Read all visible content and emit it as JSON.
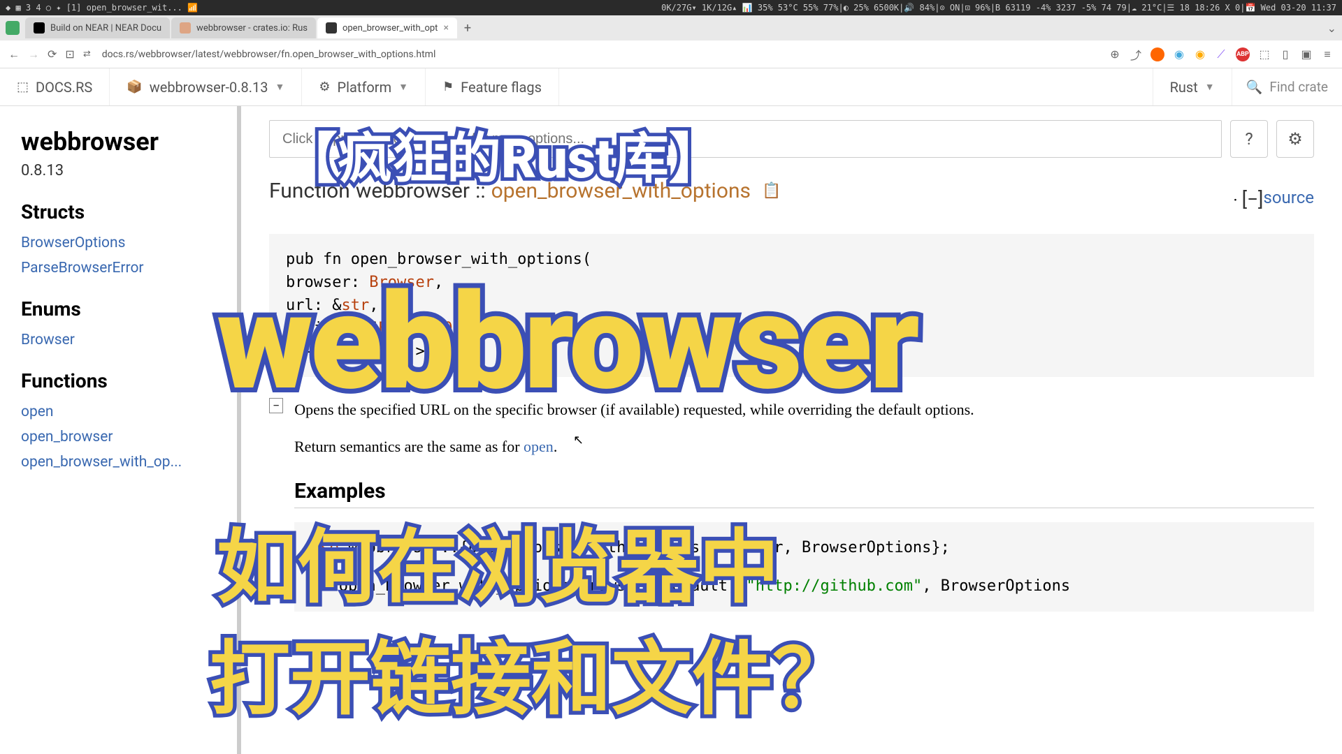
{
  "status_bar": {
    "left": [
      "◆",
      "▦",
      "3",
      "4",
      "○",
      "✦",
      "[1]",
      "open_browser_wit...",
      "📶"
    ],
    "right": [
      "0K/27G▾",
      "1K/12G▴",
      "📊 35% 53°C 55% 77%|◐ 25% 6500K|🔊 84%|⊙ ON|⊡ 96%|B 63119 -4% 3237 -5% 74 79|☁ 21°C|☰ 18 18:26 X 0|📅 Wed 03-20 11:37"
    ]
  },
  "tabs": [
    {
      "label": "Build on NEAR | NEAR Docu",
      "icon": "N"
    },
    {
      "label": "webbrowser - crates.io: Rus",
      "icon": "📦"
    },
    {
      "label": "open_browser_with_opt",
      "icon": "⊕",
      "active": true
    }
  ],
  "url": "docs.rs/webbrowser/latest/webbrowser/fn.open_browser_with_options.html",
  "docs_nav": {
    "home": "DOCS.RS",
    "crate": "webbrowser-0.8.13",
    "platform": "Platform",
    "features": "Feature flags",
    "lang": "Rust",
    "search_placeholder": "Find crate"
  },
  "sidebar": {
    "title": "webbrowser",
    "version": "0.8.13",
    "sections": [
      {
        "heading": "Structs",
        "items": [
          "BrowserOptions",
          "ParseBrowserError"
        ]
      },
      {
        "heading": "Enums",
        "items": [
          "Browser"
        ]
      },
      {
        "heading": "Functions",
        "items": [
          "open",
          "open_browser",
          "open_browser_with_op..."
        ]
      }
    ]
  },
  "content": {
    "search_placeholder": "Click or press 'S' to search, '?' for more options...",
    "fn_prefix": "Function ",
    "fn_crate": "webbrowser",
    "fn_sep": "::",
    "fn_name": "open_browser_with_options",
    "source": "source",
    "collapse": "[−]",
    "code_line1": "pub fn open_browser_with_options(",
    "code_line2": "    browser: ",
    "code_line3": "    url: &",
    "code_line4": "    options: &",
    "code_line5": ") -> Result<()>",
    "desc1": "Opens the specified URL on the specific browser (if available) requested, while overriding the default options.",
    "desc2": "Return semantics are the same as for ",
    "desc2_link": "open",
    "example_heading": "Examples",
    "code2_line1": "use webbrowser::{open_browser_with_options, Browser, BrowserOptions};",
    "code2_line2": "if open_browser_with_options(Browser::Default, \"http://github.com\", BrowserOptions"
  },
  "overlays": {
    "line1": "【疯狂的Rust库】",
    "line2": "webbrowser",
    "line3": "如何在浏览器中",
    "line4": "打开链接和文件？"
  }
}
